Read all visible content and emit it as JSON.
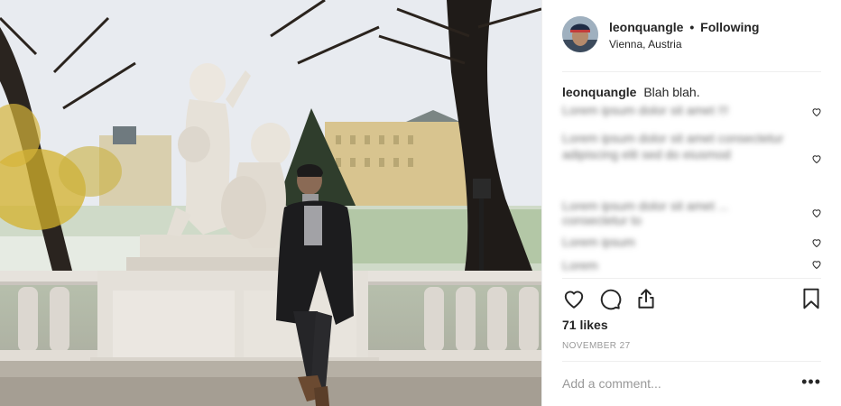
{
  "post": {
    "username": "leonquangle",
    "follow_status": "Following",
    "separator": "•",
    "location": "Vienna, Austria",
    "caption_user": "leonquangle",
    "caption_text": "Blah blah.",
    "likes": "71 likes",
    "date": "NOVEMBER 27"
  },
  "comments": [
    {
      "text": "Lorem ipsum dolor sit amet !!!",
      "liked": false
    },
    {
      "text": "Lorem ipsum dolor sit amet consectetur adipiscing elit sed do eiusmod",
      "liked": false
    },
    {
      "text": "Lorem ipsum dolor sit amet ... consectetur to",
      "liked": false
    },
    {
      "text": "Lorem ipsum",
      "liked": false
    },
    {
      "text": "Lorem",
      "liked": false
    }
  ],
  "comment_box": {
    "placeholder": "Add a comment...",
    "more": "•••"
  },
  "icons": {
    "like": "heart-icon",
    "comment": "comment-icon",
    "share": "share-icon",
    "save": "bookmark-icon",
    "more": "more-options-icon"
  }
}
